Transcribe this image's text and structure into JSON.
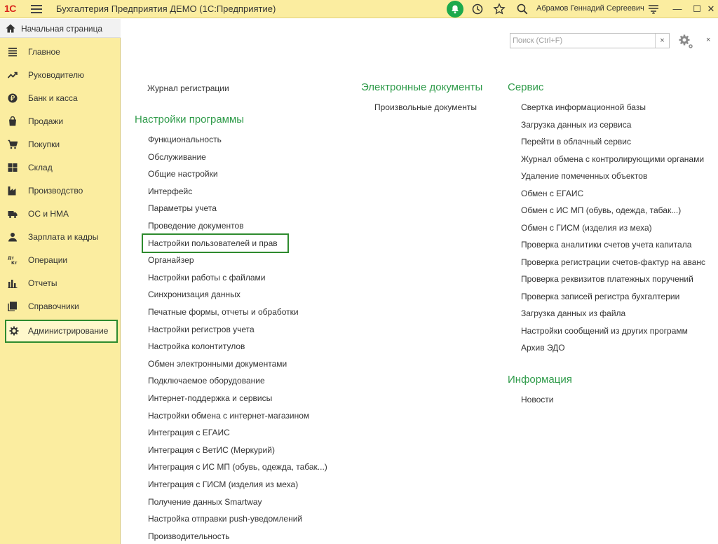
{
  "app": {
    "logo": "1С",
    "title": "Бухгалтерия Предприятия ДЕМО  (1С:Предприятие)",
    "user": "Абрамов Геннадий Сергеевич",
    "minimize": "—",
    "maximize": "☐",
    "close": "✕"
  },
  "home_tab": {
    "label": "Начальная страница"
  },
  "sidebar": {
    "items": [
      {
        "label": "Главное",
        "icon": "list-icon"
      },
      {
        "label": "Руководителю",
        "icon": "trend-icon"
      },
      {
        "label": "Банк и касса",
        "icon": "ruble-icon"
      },
      {
        "label": "Продажи",
        "icon": "bag-icon"
      },
      {
        "label": "Покупки",
        "icon": "cart-icon"
      },
      {
        "label": "Склад",
        "icon": "warehouse-icon"
      },
      {
        "label": "Производство",
        "icon": "factory-icon"
      },
      {
        "label": "ОС и НМА",
        "icon": "truck-icon"
      },
      {
        "label": "Зарплата и кадры",
        "icon": "person-icon"
      },
      {
        "label": "Операции",
        "icon": "dt-kt-icon"
      },
      {
        "label": "Отчеты",
        "icon": "bar-chart-icon"
      },
      {
        "label": "Справочники",
        "icon": "books-icon"
      },
      {
        "label": "Администрирование",
        "icon": "gear-icon",
        "active": true
      }
    ]
  },
  "search": {
    "placeholder": "Поиск (Ctrl+F)",
    "clear": "×"
  },
  "main": {
    "close_label": "×",
    "col1": {
      "top_link": "Журнал регистрации",
      "heading": "Настройки программы",
      "links": [
        "Функциональность",
        "Обслуживание",
        "Общие настройки",
        "Интерфейс",
        "Параметры учета",
        "Проведение документов",
        "Настройки пользователей и прав",
        "Органайзер",
        "Настройки работы с файлами",
        "Синхронизация данных",
        "Печатные формы, отчеты и обработки",
        "Настройки регистров учета",
        "Настройка колонтитулов",
        "Обмен электронными документами",
        "Подключаемое оборудование",
        "Интернет-поддержка и сервисы",
        "Настройки обмена с интернет-магазином",
        "Интеграция с ЕГАИС",
        "Интеграция с ВетИС (Меркурий)",
        "Интеграция с ИС МП (обувь, одежда, табак...)",
        "Интеграция с ГИСМ (изделия из меха)",
        "Получение данных Smartway",
        "Настройка отправки push-уведомлений",
        "Производительность"
      ]
    },
    "col2": {
      "heading": "Электронные документы",
      "links": [
        "Произвольные документы"
      ]
    },
    "col3": {
      "heading": "Сервис",
      "links": [
        "Свертка информационной базы",
        "Загрузка данных из сервиса",
        "Перейти в облачный сервис",
        "Журнал обмена с контролирующими органами",
        "Удаление помеченных объектов",
        "Обмен с ЕГАИС",
        "Обмен с ИС МП (обувь, одежда, табак...)",
        "Обмен с ГИСМ (изделия из меха)",
        "Проверка аналитики счетов учета капитала",
        "Проверка регистрации счетов-фактур на аванс",
        "Проверка реквизитов платежных поручений",
        "Проверка записей регистра бухгалтерии",
        "Загрузка данных из файла",
        "Настройки сообщений из других программ",
        "Архив ЭДО"
      ],
      "heading2": "Информация",
      "links2": [
        "Новости"
      ]
    }
  },
  "colors": {
    "sidebar_bg": "#fbeda0",
    "heading": "#2f9b4a",
    "highlight_border": "#2e8b2e",
    "bell_bg": "#1da94c",
    "logo": "#d9261c"
  }
}
